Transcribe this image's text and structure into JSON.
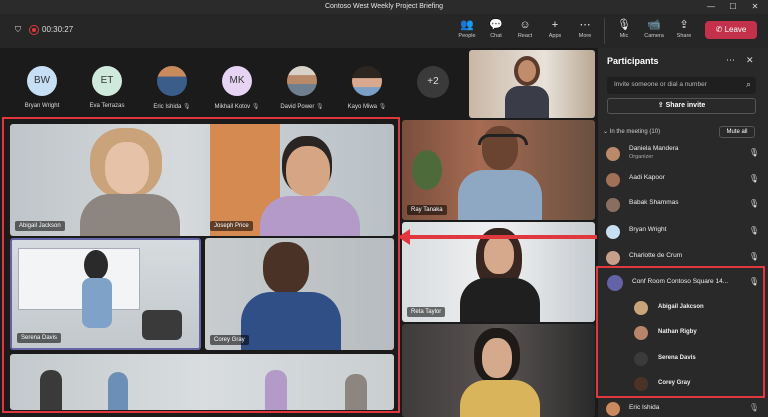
{
  "window": {
    "title": "Contoso West Weekly Project Briefing",
    "minimize": "—",
    "maximize": "☐",
    "close": "✕"
  },
  "meeting": {
    "timer": "00:30:27"
  },
  "toolbar": {
    "people": "People",
    "chat": "Chat",
    "react": "React",
    "apps": "Apps",
    "more": "More",
    "mic": "Mic",
    "camera": "Camera",
    "share": "Share",
    "leave": "Leave"
  },
  "gallery": {
    "people": [
      {
        "initials": "BW",
        "name": "Bryan Wright",
        "color": "#c6dff5"
      },
      {
        "initials": "ET",
        "name": "Eva Terrazas",
        "color": "#cfeadd"
      },
      {
        "initials": "",
        "name": "Eric Ishida",
        "color": "#8a6f5a"
      },
      {
        "initials": "MK",
        "name": "Mikhail Kotov",
        "color": "#e7d3f3"
      },
      {
        "initials": "",
        "name": "David Power",
        "color": "#9a8a7c"
      },
      {
        "initials": "",
        "name": "Kayo Miwa",
        "color": "#7c5e50"
      }
    ],
    "overflow": "+2"
  },
  "room_tiles": {
    "abigail": "Abigail Jackson",
    "joseph": "Joseph Price",
    "serena": "Serena Davis",
    "corey": "Corey Gray"
  },
  "side_tiles": {
    "ray": "Ray Tanaka",
    "reta": "Reta Taylor"
  },
  "panel": {
    "title": "Participants",
    "invite_placeholder": "Invite someone or dial a number",
    "share_invite": "Share invite",
    "section": "In the meeting (10)",
    "mute_all": "Mute all",
    "participants": [
      {
        "name": "Daniela Mandera",
        "role": "Organizer"
      },
      {
        "name": "Aadi Kapoor"
      },
      {
        "name": "Babak Shammas"
      },
      {
        "name": "Bryan Wright"
      },
      {
        "name": "Charlotte de Crum"
      }
    ],
    "room": {
      "name": "Conf Room Contoso Square 14...",
      "members": [
        "Abigail Jakcson",
        "Nathan Rigby",
        "Serena Davis",
        "Corey Gray"
      ]
    },
    "last": "Eric Ishida"
  },
  "colors": {
    "accent": "#6264a7",
    "leave": "#c4314b",
    "highlight": "#e0383e"
  }
}
